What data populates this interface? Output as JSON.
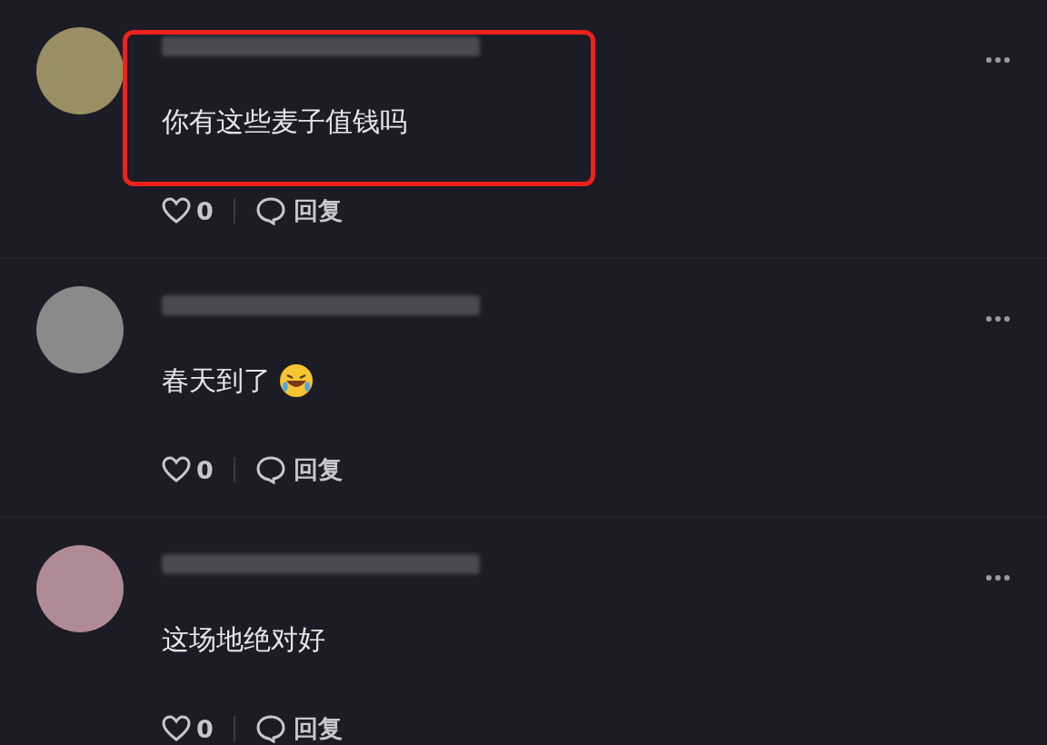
{
  "comments": [
    {
      "text": "你有这些麦子值钱吗",
      "kind": "text",
      "likes": "0",
      "reply": "回复",
      "highlighted": true
    },
    {
      "text": "春天到了",
      "kind": "emoji",
      "likes": "0",
      "reply": "回复",
      "highlighted": false
    },
    {
      "text": "这场地绝对好",
      "kind": "text",
      "likes": "0",
      "reply": "回复",
      "highlighted": false
    }
  ]
}
